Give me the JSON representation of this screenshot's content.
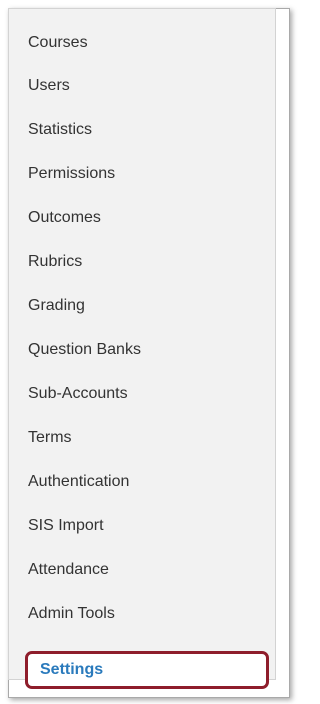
{
  "nav": {
    "items": [
      {
        "label": "Courses"
      },
      {
        "label": "Users"
      },
      {
        "label": "Statistics"
      },
      {
        "label": "Permissions"
      },
      {
        "label": "Outcomes"
      },
      {
        "label": "Rubrics"
      },
      {
        "label": "Grading"
      },
      {
        "label": "Question Banks"
      },
      {
        "label": "Sub-Accounts"
      },
      {
        "label": "Terms"
      },
      {
        "label": "Authentication"
      },
      {
        "label": "SIS Import"
      },
      {
        "label": "Attendance"
      },
      {
        "label": "Admin Tools"
      },
      {
        "label": "Settings",
        "active": true
      }
    ]
  },
  "colors": {
    "active_text": "#2a7abc",
    "highlight_border": "#8e1d2b",
    "nav_background": "#f2f2f2",
    "text": "#333333"
  }
}
